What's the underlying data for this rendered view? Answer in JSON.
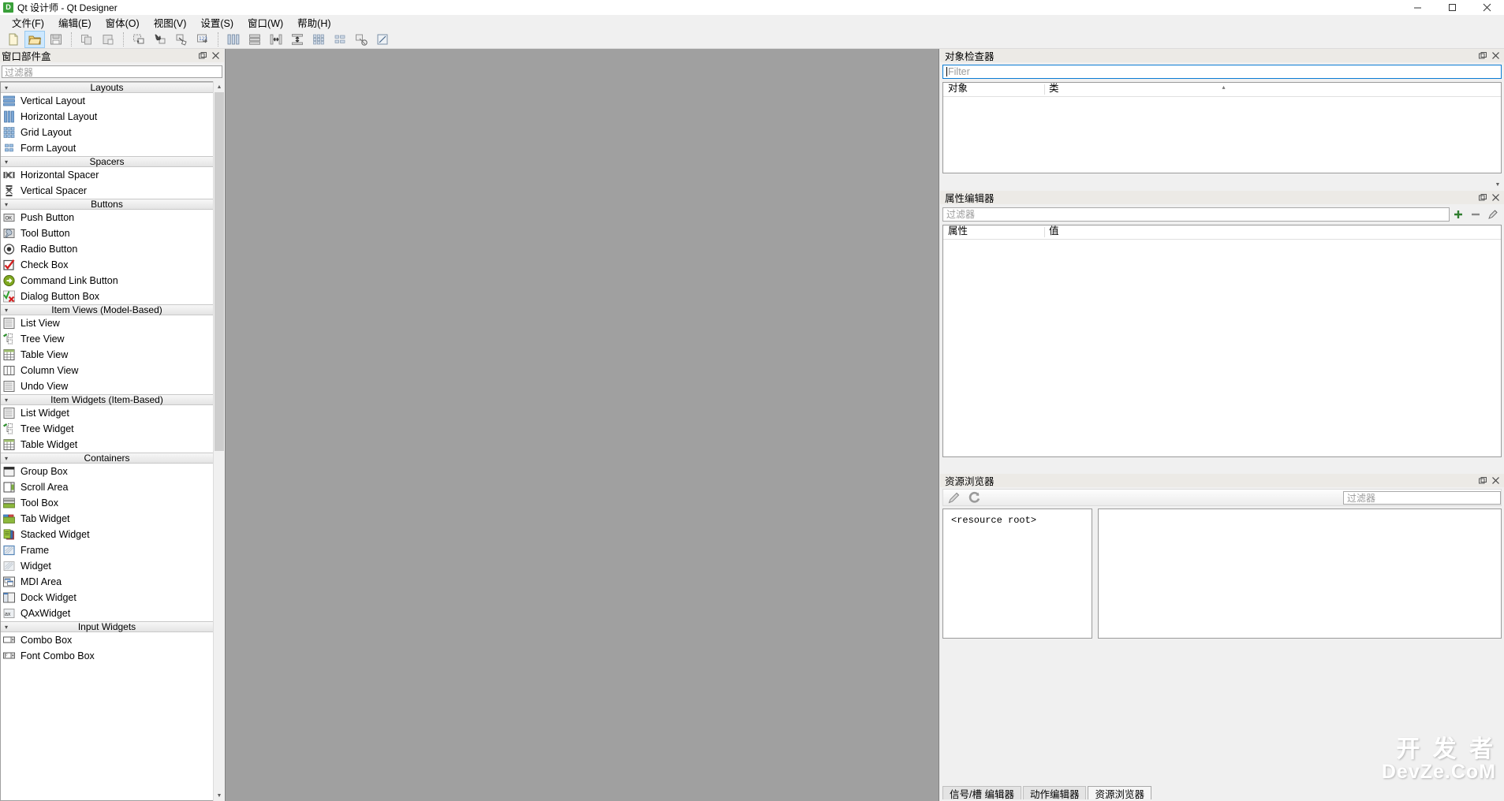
{
  "window": {
    "title": "Qt 设计师 - Qt Designer",
    "app_icon": "D",
    "minimize": "minimize-icon",
    "maximize": "maximize-icon",
    "close": "close-icon"
  },
  "menubar": {
    "items": [
      {
        "label": "文件(F)",
        "name": "menu-file"
      },
      {
        "label": "编辑(E)",
        "name": "menu-edit"
      },
      {
        "label": "窗体(O)",
        "name": "menu-form"
      },
      {
        "label": "视图(V)",
        "name": "menu-view"
      },
      {
        "label": "设置(S)",
        "name": "menu-settings"
      },
      {
        "label": "窗口(W)",
        "name": "menu-window"
      },
      {
        "label": "帮助(H)",
        "name": "menu-help"
      }
    ]
  },
  "toolbar": {
    "groups": [
      [
        {
          "icon": "new-form-icon",
          "name": "new-form-button",
          "active": false
        },
        {
          "icon": "open-folder-icon",
          "name": "open-form-button",
          "active": true
        },
        {
          "icon": "save-icon",
          "name": "save-form-button",
          "active": false
        }
      ],
      [
        {
          "icon": "copy-icon",
          "name": "copy-button",
          "active": false
        },
        {
          "icon": "paste-icon",
          "name": "paste-button",
          "active": false
        }
      ],
      [
        {
          "icon": "edit-widgets-icon",
          "name": "edit-widgets-button",
          "active": false
        },
        {
          "icon": "edit-signals-slots-icon",
          "name": "edit-signals-slots-button",
          "active": false
        },
        {
          "icon": "edit-buddies-icon",
          "name": "edit-buddies-button",
          "active": false
        },
        {
          "icon": "edit-tab-order-icon",
          "name": "edit-tab-order-button",
          "active": false
        }
      ],
      [
        {
          "icon": "layout-horizontal-icon",
          "name": "layout-horizontally-button",
          "active": false
        },
        {
          "icon": "layout-vertical-icon",
          "name": "layout-vertically-button",
          "active": false
        },
        {
          "icon": "layout-splitter-h-icon",
          "name": "layout-splitter-horizontal-button",
          "active": false
        },
        {
          "icon": "layout-splitter-v-icon",
          "name": "layout-splitter-vertical-button",
          "active": false
        },
        {
          "icon": "layout-grid-icon",
          "name": "layout-grid-button",
          "active": false
        },
        {
          "icon": "layout-form-icon",
          "name": "layout-form-button",
          "active": false
        },
        {
          "icon": "break-layout-icon",
          "name": "break-layout-button",
          "active": false
        },
        {
          "icon": "adjust-size-icon",
          "name": "adjust-size-button",
          "active": false
        }
      ]
    ]
  },
  "widget_box": {
    "title": "窗口部件盒",
    "float_button": "float-icon",
    "close_button": "close-icon",
    "filter_placeholder": "过滤器",
    "categories": [
      {
        "name": "Layouts",
        "items": [
          {
            "label": "Vertical Layout",
            "icon": "vertical-layout-icon"
          },
          {
            "label": "Horizontal Layout",
            "icon": "horizontal-layout-icon"
          },
          {
            "label": "Grid Layout",
            "icon": "grid-layout-icon"
          },
          {
            "label": "Form Layout",
            "icon": "form-layout-icon"
          }
        ]
      },
      {
        "name": "Spacers",
        "items": [
          {
            "label": "Horizontal Spacer",
            "icon": "horizontal-spacer-icon"
          },
          {
            "label": "Vertical Spacer",
            "icon": "vertical-spacer-icon"
          }
        ]
      },
      {
        "name": "Buttons",
        "items": [
          {
            "label": "Push Button",
            "icon": "push-button-icon"
          },
          {
            "label": "Tool Button",
            "icon": "tool-button-icon"
          },
          {
            "label": "Radio Button",
            "icon": "radio-button-icon"
          },
          {
            "label": "Check Box",
            "icon": "check-box-icon"
          },
          {
            "label": "Command Link Button",
            "icon": "command-link-button-icon"
          },
          {
            "label": "Dialog Button Box",
            "icon": "dialog-button-box-icon"
          }
        ]
      },
      {
        "name": "Item Views (Model-Based)",
        "items": [
          {
            "label": "List View",
            "icon": "list-view-icon"
          },
          {
            "label": "Tree View",
            "icon": "tree-view-icon"
          },
          {
            "label": "Table View",
            "icon": "table-view-icon"
          },
          {
            "label": "Column View",
            "icon": "column-view-icon"
          },
          {
            "label": "Undo View",
            "icon": "undo-view-icon"
          }
        ]
      },
      {
        "name": "Item Widgets (Item-Based)",
        "items": [
          {
            "label": "List Widget",
            "icon": "list-widget-icon"
          },
          {
            "label": "Tree Widget",
            "icon": "tree-widget-icon"
          },
          {
            "label": "Table Widget",
            "icon": "table-widget-icon"
          }
        ]
      },
      {
        "name": "Containers",
        "items": [
          {
            "label": "Group Box",
            "icon": "group-box-icon"
          },
          {
            "label": "Scroll Area",
            "icon": "scroll-area-icon"
          },
          {
            "label": "Tool Box",
            "icon": "tool-box-icon"
          },
          {
            "label": "Tab Widget",
            "icon": "tab-widget-icon"
          },
          {
            "label": "Stacked Widget",
            "icon": "stacked-widget-icon"
          },
          {
            "label": "Frame",
            "icon": "frame-icon"
          },
          {
            "label": "Widget",
            "icon": "widget-icon"
          },
          {
            "label": "MDI Area",
            "icon": "mdi-area-icon"
          },
          {
            "label": "Dock Widget",
            "icon": "dock-widget-icon"
          },
          {
            "label": "QAxWidget",
            "icon": "qax-widget-icon"
          }
        ]
      },
      {
        "name": "Input Widgets",
        "items": [
          {
            "label": "Combo Box",
            "icon": "combo-box-icon"
          },
          {
            "label": "Font Combo Box",
            "icon": "font-combo-box-icon"
          }
        ]
      }
    ]
  },
  "object_inspector": {
    "title": "对象检查器",
    "float_button": "float-icon",
    "close_button": "close-icon",
    "filter_placeholder": "Filter",
    "columns": [
      "对象",
      "类"
    ],
    "rows": []
  },
  "property_editor": {
    "title": "属性编辑器",
    "float_button": "float-icon",
    "close_button": "close-icon",
    "filter_placeholder": "过滤器",
    "add_button": "plus-icon",
    "remove_button": "minus-icon",
    "config_button": "configure-icon",
    "columns": [
      "属性",
      "值"
    ],
    "rows": []
  },
  "resource_browser": {
    "title": "资源浏览器",
    "float_button": "float-icon",
    "close_button": "close-icon",
    "edit_button": "pencil-icon",
    "reload_button": "reload-icon",
    "filter_placeholder": "过滤器",
    "root_label": "<resource root>"
  },
  "bottom_tabs": [
    {
      "label": "信号/槽 编辑器",
      "selected": false
    },
    {
      "label": "动作编辑器",
      "selected": false
    },
    {
      "label": "资源浏览器",
      "selected": true
    }
  ],
  "watermark": {
    "line1": "开 发 者",
    "line2": "DevZe.CoM"
  },
  "colors": {
    "canvas": "#a0a0a0",
    "chrome": "#f0f0f0",
    "accent": "#0a7cd4",
    "dock_title": "#eceae6"
  }
}
